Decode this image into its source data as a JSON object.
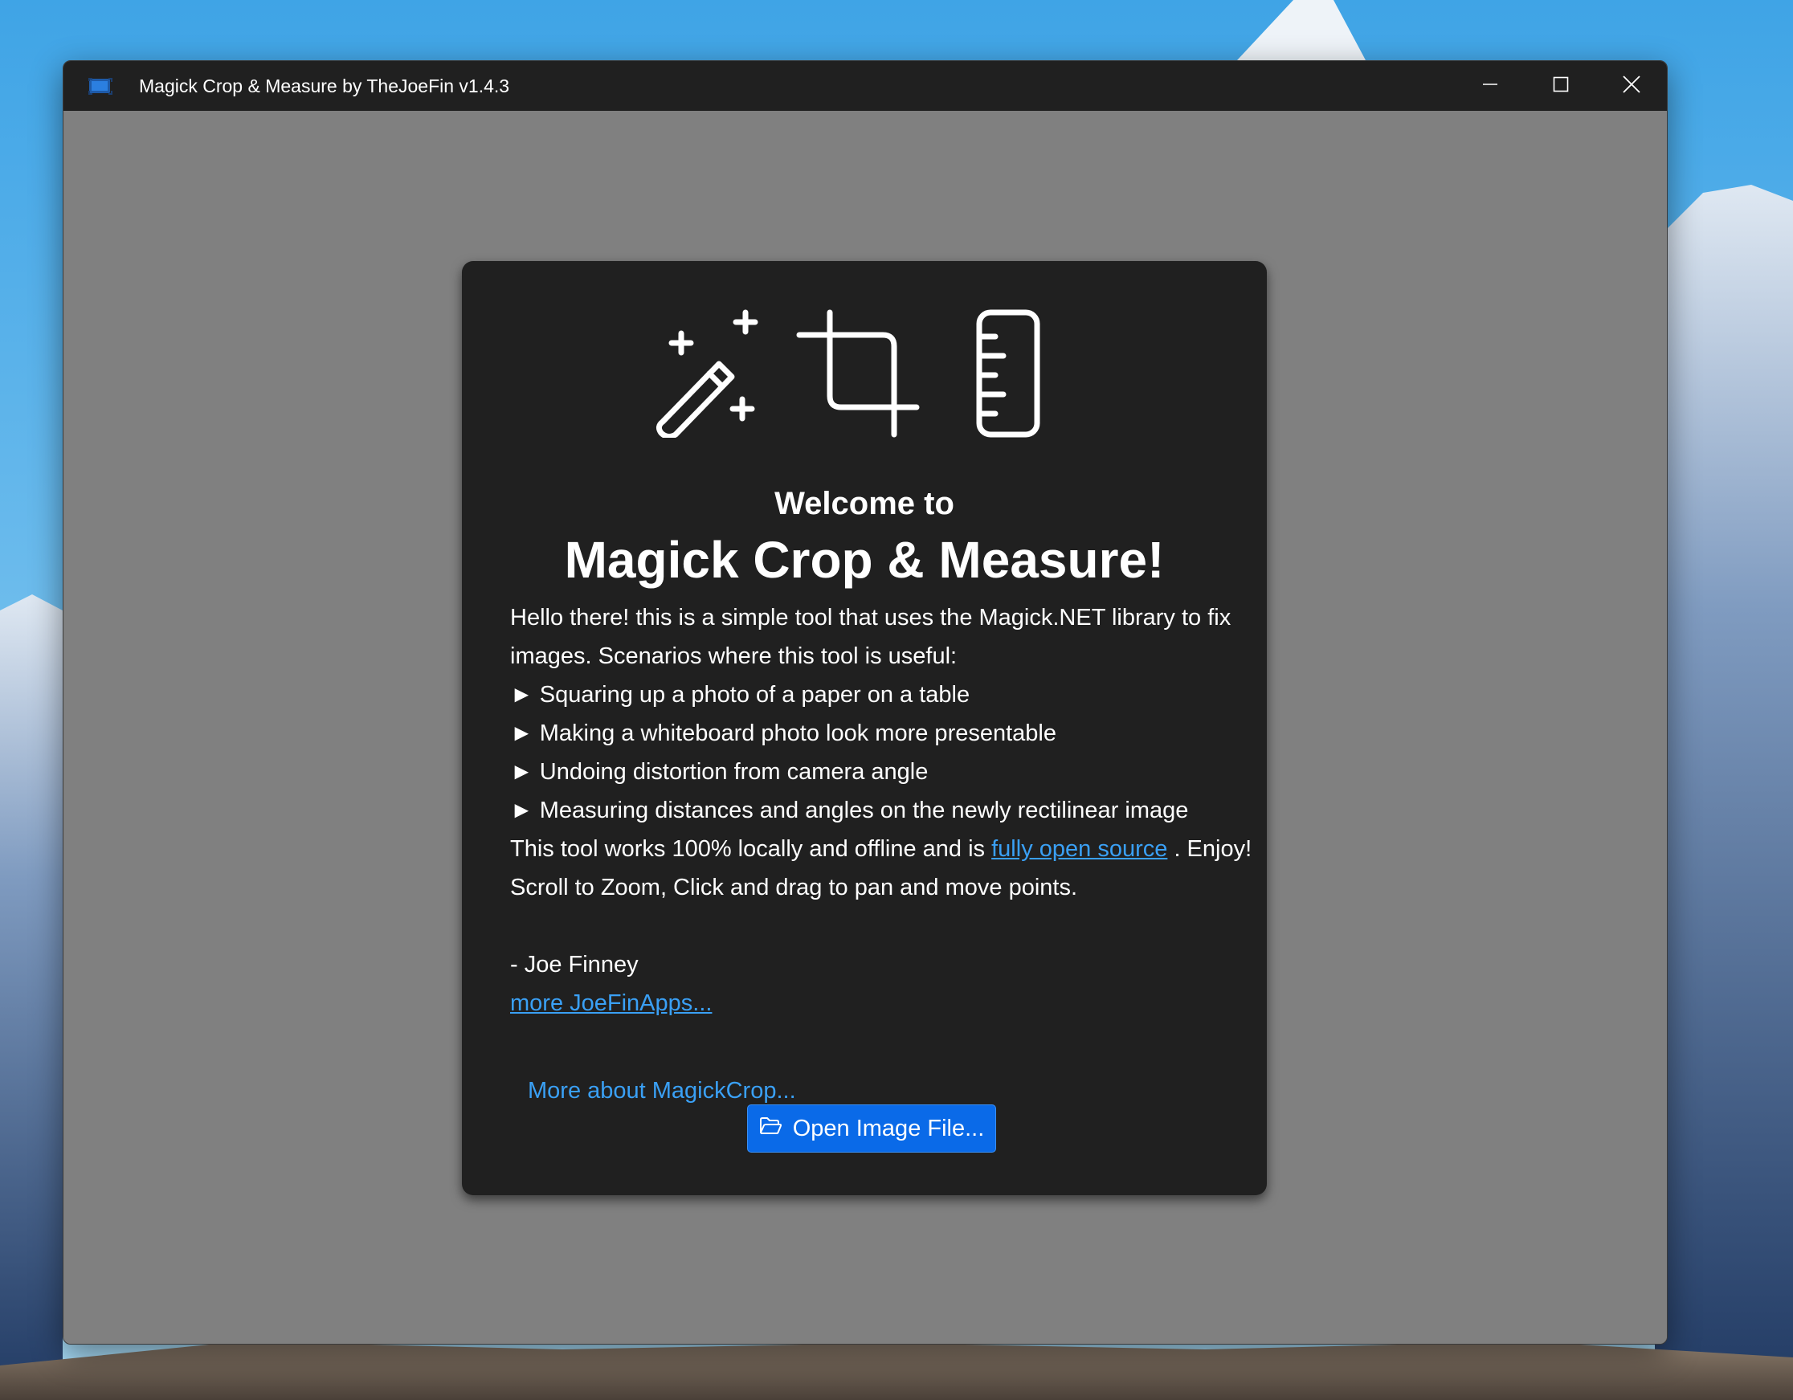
{
  "window": {
    "title": "Magick Crop & Measure by TheJoeFin v1.4.3",
    "app_icon": "app-logo-icon",
    "controls": [
      "minimize-icon",
      "maximize-icon",
      "close-icon"
    ]
  },
  "card": {
    "icons": [
      "magic-wand-icon",
      "crop-icon",
      "ruler-icon"
    ],
    "welcome": "Welcome to",
    "title": "Magick Crop & Measure!",
    "intro": "Hello there! this is a simple tool that uses the Magick.NET library to fix images. Scenarios where this tool is useful:",
    "bullets": [
      "Squaring up a photo of a paper on a table",
      "Making a whiteboard photo look more presentable",
      "Undoing distortion from camera angle",
      "Measuring distances and angles on the newly rectilinear image"
    ],
    "local_text_before": "This tool works 100% locally and offline and is",
    "open_source_link": "fully open source",
    "local_text_after": ". Enjoy!",
    "usage": "Scroll to Zoom, Click and drag to pan and move points.",
    "signature": "- Joe Finney",
    "more_apps_link": "more JoeFinApps...",
    "more_about_link": "More about MagickCrop...",
    "open_button": {
      "label": "Open Image File...",
      "icon": "folder-open-icon"
    }
  },
  "colors": {
    "titlebar": "#202020",
    "window_bg": "#808080",
    "card_bg": "#202020",
    "accent": "#0a6ae8",
    "link": "#3aa0f5"
  }
}
